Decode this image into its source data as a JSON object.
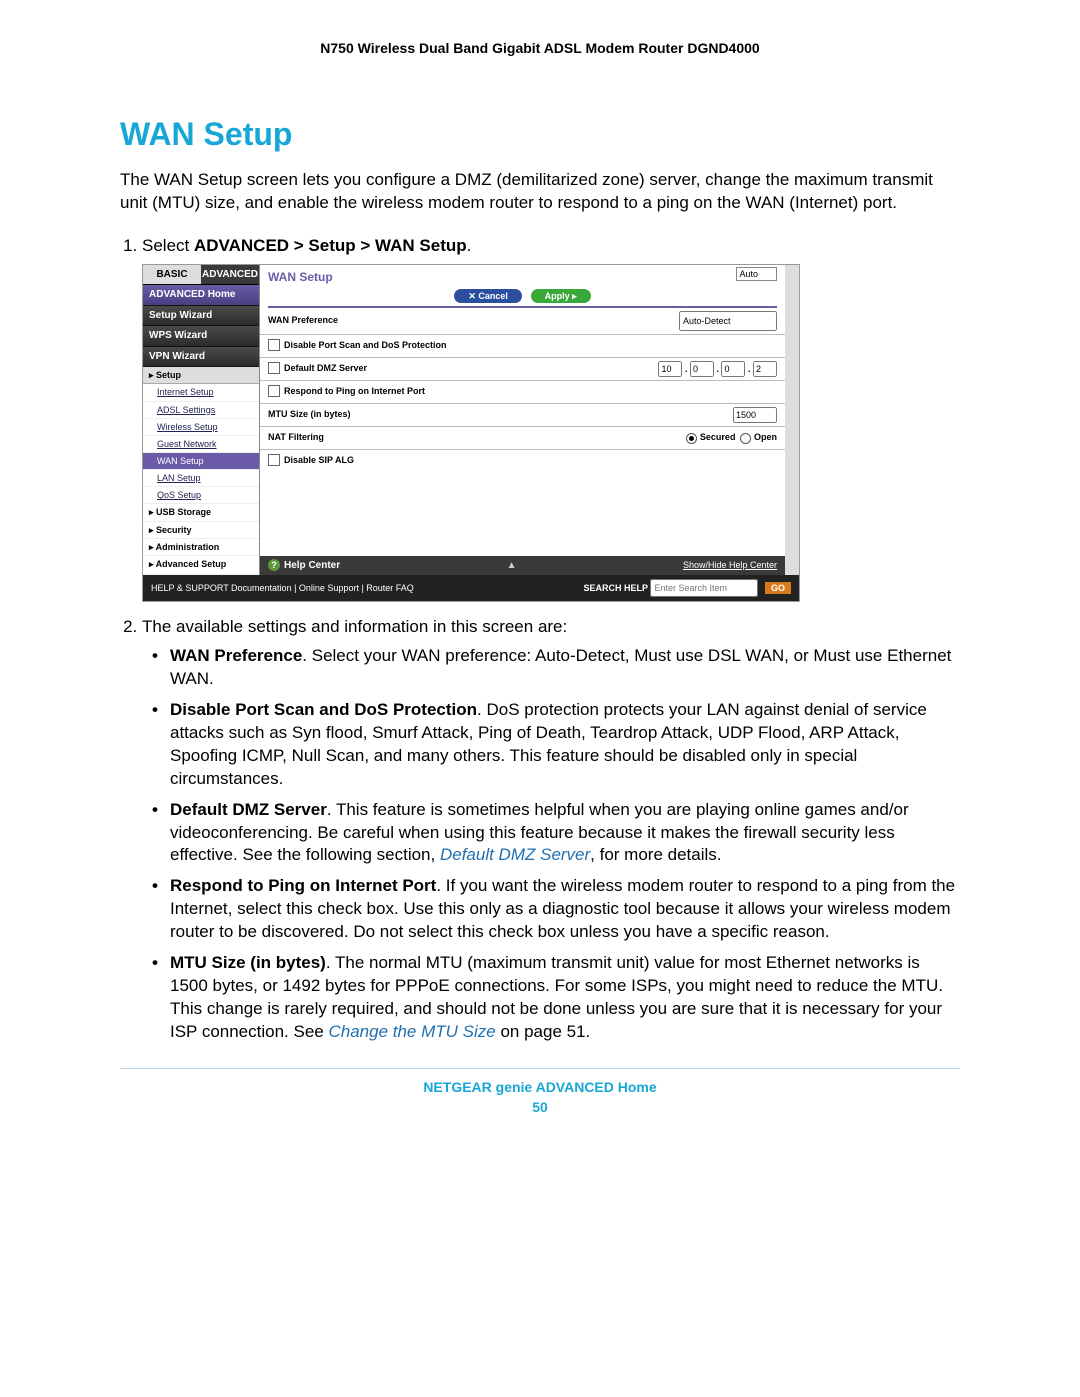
{
  "header": "N750 Wireless Dual Band Gigabit ADSL Modem Router DGND4000",
  "section_title": "WAN Setup",
  "intro": "The WAN Setup screen lets you configure a DMZ (demilitarized zone) server, change the maximum transmit unit (MTU) size, and enable the wireless modem router to respond to a ping on the WAN (Internet) port.",
  "step1_prefix": "Select ",
  "step1_bold": "ADVANCED > Setup > WAN Setup",
  "step1_suffix": ".",
  "step2": "The available settings and information in this screen are:",
  "bullets": {
    "b1_bold": "WAN Preference",
    "b1_rest": ". Select your WAN preference: Auto-Detect, Must use DSL WAN, or Must use Ethernet WAN.",
    "b2_bold": "Disable Port Scan and DoS Protection",
    "b2_rest": ". DoS protection protects your LAN against denial of service attacks such as Syn flood, Smurf Attack, Ping of Death, Teardrop Attack, UDP Flood, ARP Attack, Spoofing ICMP, Null Scan, and many others. This feature should be disabled only in special circumstances.",
    "b3_bold": "Default DMZ Server",
    "b3_a": ". This feature is sometimes helpful when you are playing online games and/or videoconferencing. Be careful when using this feature because it makes the firewall security less effective. See the following section, ",
    "b3_link": "Default DMZ Server",
    "b3_b": ", for more details.",
    "b4_bold": "Respond to Ping on Internet Port",
    "b4_rest": ". If you want the wireless modem router to respond to a ping from the Internet, select this check box. Use this only as a diagnostic tool because it allows your wireless modem router to be discovered. Do not select this check box unless you have a specific reason.",
    "b5_bold": "MTU Size (in bytes)",
    "b5_a": ". The normal MTU (maximum transmit unit) value for most Ethernet networks is 1500 bytes, or 1492 bytes for PPPoE connections. For some ISPs, you might need to reduce the MTU. This change is rarely required, and should not be done unless you are sure that it is necessary for your ISP connection. See ",
    "b5_link": "Change the MTU Size",
    "b5_b": " on page 51."
  },
  "footer": {
    "line1": "NETGEAR genie ADVANCED Home",
    "line2": "50"
  },
  "shot": {
    "tabs": {
      "basic": "BASIC",
      "advanced": "ADVANCED"
    },
    "auto": "Auto",
    "nav": {
      "home": "ADVANCED Home",
      "setup_wizard": "Setup Wizard",
      "wps_wizard": "WPS Wizard",
      "vpn_wizard": "VPN Wizard",
      "setup": "▸ Setup",
      "internet_setup": "Internet Setup",
      "adsl_settings": "ADSL Settings",
      "wireless_setup": "Wireless Setup",
      "guest_network": "Guest Network",
      "wan_setup": "WAN Setup",
      "lan_setup": "LAN Setup",
      "qos_setup": "QoS Setup",
      "usb_storage": "▸ USB Storage",
      "security": "▸ Security",
      "administration": "▸ Administration",
      "advanced_setup": "▸ Advanced Setup"
    },
    "panel_title": "WAN Setup",
    "btn_cancel": "✕   Cancel",
    "btn_apply": "Apply    ▸",
    "rows": {
      "wan_pref": "WAN Preference",
      "wan_pref_val": "Auto-Detect",
      "disable_dos": "Disable Port Scan and DoS Protection",
      "dmz": "Default DMZ Server",
      "dmz_ip": [
        "10",
        "0",
        "0",
        "2"
      ],
      "ping": "Respond to Ping on Internet Port",
      "mtu": "MTU Size (in bytes)",
      "mtu_val": "1500",
      "nat": "NAT Filtering",
      "nat_secured": "Secured",
      "nat_open": "Open",
      "sip": "Disable SIP ALG"
    },
    "help_center": "Help Center",
    "show_hide": "Show/Hide Help Center",
    "support": "HELP & SUPPORT  Documentation | Online Support | Router FAQ",
    "search_label": "SEARCH HELP",
    "search_ph": "Enter Search Item",
    "go": "GO"
  }
}
